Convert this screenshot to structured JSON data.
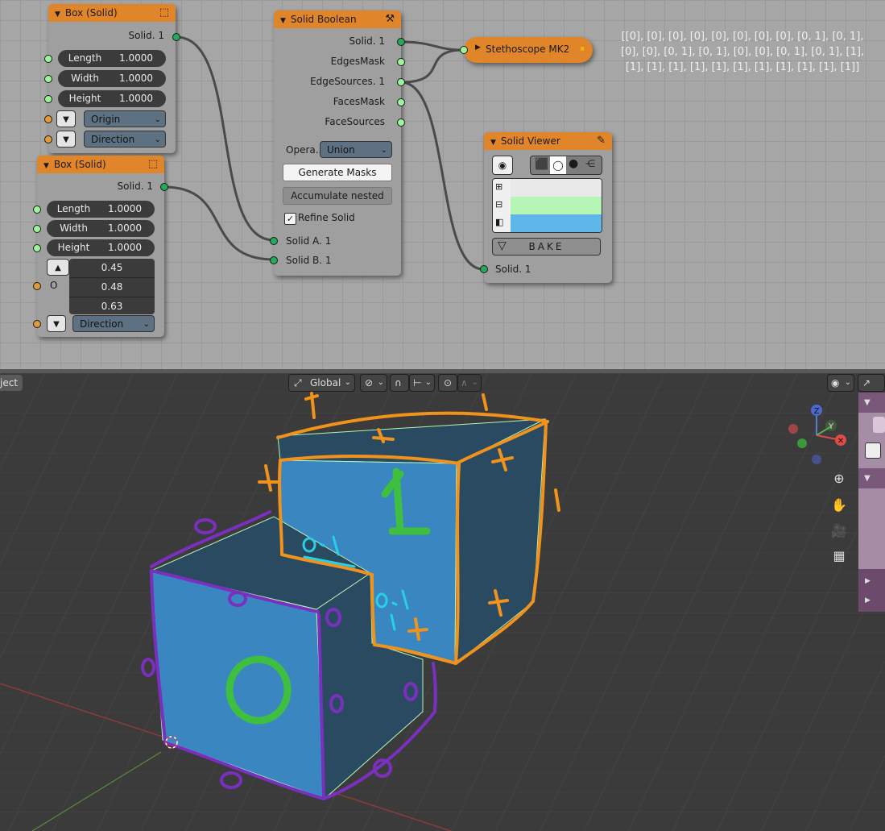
{
  "box1": {
    "title": "Box (Solid)",
    "output": "Solid. 1",
    "fields": [
      {
        "label": "Length",
        "value": "1.0000"
      },
      {
        "label": "Width",
        "value": "1.0000"
      },
      {
        "label": "Height",
        "value": "1.0000"
      }
    ],
    "origin": "Origin",
    "direction": "Direction"
  },
  "box2": {
    "title": "Box (Solid)",
    "output": "Solid. 1",
    "fields": [
      {
        "label": "Length",
        "value": "1.0000"
      },
      {
        "label": "Width",
        "value": "1.0000"
      },
      {
        "label": "Height",
        "value": "1.0000"
      }
    ],
    "origin_label": "O",
    "origin_values": [
      "0.45",
      "0.48",
      "0.63"
    ],
    "direction": "Direction"
  },
  "boolean": {
    "title": "Solid Boolean",
    "outputs": [
      "Solid. 1",
      "EdgesMask",
      "EdgeSources. 1",
      "FacesMask",
      "FaceSources"
    ],
    "operation_label": "Opera...",
    "operation_value": "Union",
    "generate_masks": "Generate Masks",
    "accumulate_nested": "Accumulate nested",
    "refine_solid": "Refine Solid",
    "refine_checked": true,
    "inputs": [
      "Solid A. 1",
      "Solid B. 1"
    ]
  },
  "stethoscope": {
    "title": "Stethoscope MK2",
    "output_text": [
      "[[0], [0], [0], [0], [0], [0], [0], [0], [0, 1], [0, 1],",
      "[0], [0], [0, 1], [0, 1], [0], [0], [0, 1], [0, 1], [1],",
      "[1], [1], [1], [1], [1], [1], [1], [1], [1], [1], [1]]"
    ]
  },
  "viewer": {
    "title": "Solid Viewer",
    "bake": "BAKE",
    "input": "Solid. 1",
    "vertex_color": "#e9e9e9",
    "edge_color": "#b5f5b5",
    "face_color": "#5fb6e8"
  },
  "viewport": {
    "mode_label": "ject",
    "transform_orientation": "Global",
    "gizmo_axes": [
      "Z",
      "Y"
    ]
  }
}
